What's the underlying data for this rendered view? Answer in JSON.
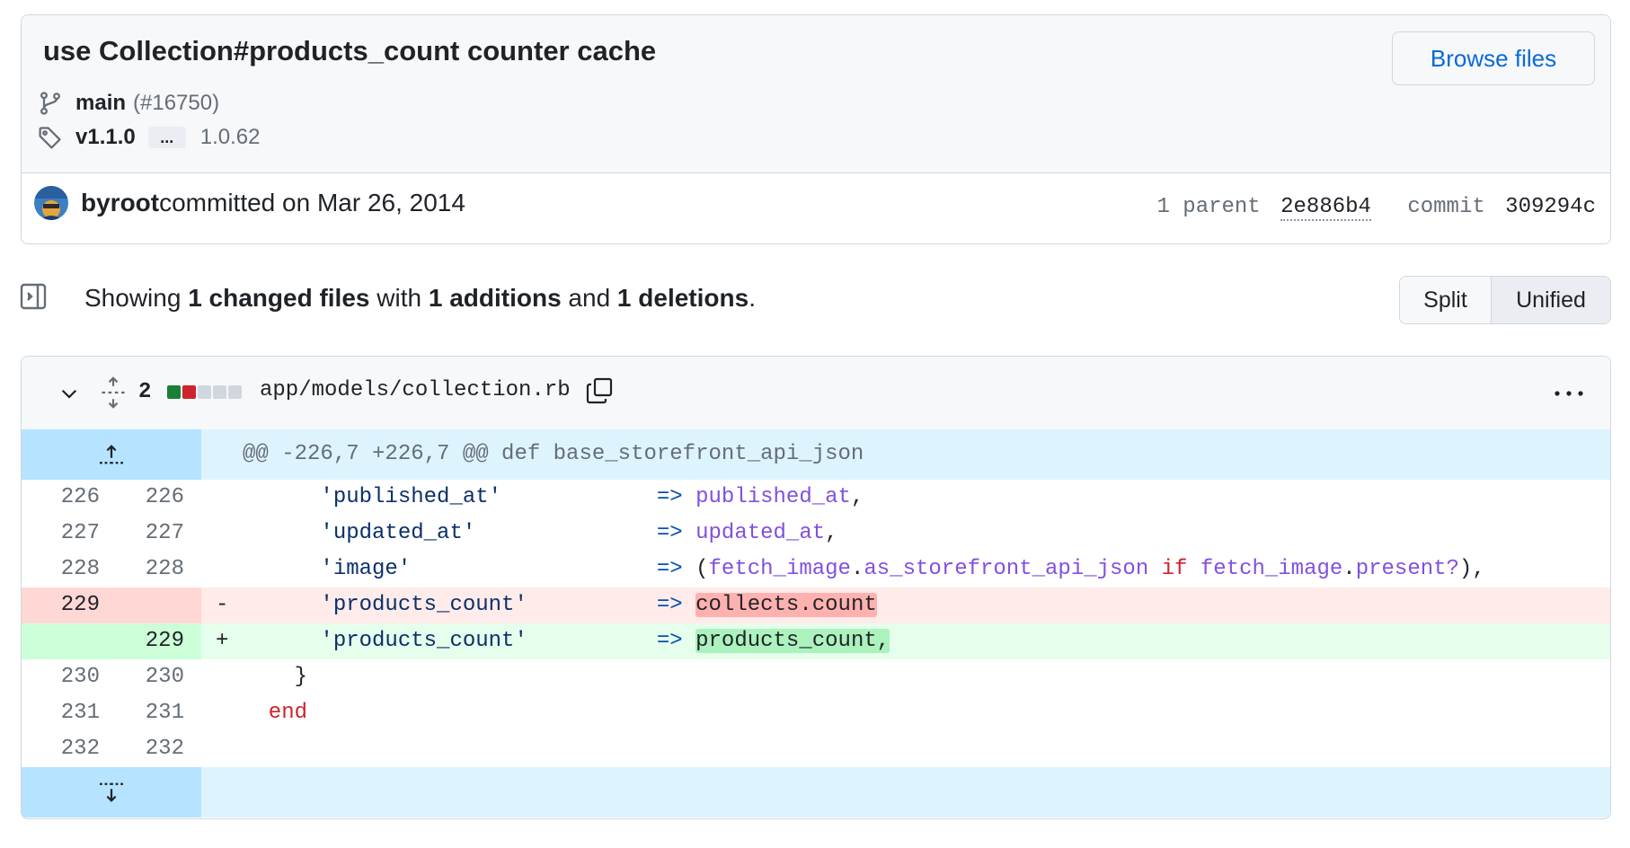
{
  "commit": {
    "title": "use Collection#products_count counter cache",
    "browse_files": "Browse files",
    "branch": "main",
    "pr": "(#16750)",
    "tag": "v1.1.0",
    "tag_ellipsis": "...",
    "tag_other": "1.0.62",
    "author": "byroot",
    "committed_text": " committed on Mar 26, 2014",
    "parent_label": "1 parent",
    "parent_sha": "2e886b4",
    "commit_label": "commit",
    "commit_sha": "309294c"
  },
  "summary": {
    "showing": "Showing ",
    "changed_files": "1 changed files",
    "with": " with ",
    "additions": "1 additions",
    "and": " and ",
    "deletions": "1 deletions",
    "period": ".",
    "split": "Split",
    "unified": "Unified"
  },
  "file": {
    "change_count": "2",
    "name": "app/models/collection.rb",
    "diffstat": [
      "#1a7f37",
      "#cf222e",
      "#d0d7de",
      "#d0d7de",
      "#d0d7de"
    ]
  },
  "diff": {
    "hunk_header": "@@ -226,7 +226,7 @@ def base_storefront_api_json",
    "lines": [
      {
        "type": "ctx",
        "old": "226",
        "new": "226",
        "key": "'published_at'",
        "arrow": "=>",
        "value": "published_at",
        "tail": ","
      },
      {
        "type": "ctx",
        "old": "227",
        "new": "227",
        "key": "'updated_at'",
        "arrow": "=>",
        "value": "updated_at",
        "tail": ","
      },
      {
        "type": "ctx",
        "old": "228",
        "new": "228",
        "key": "'image'",
        "arrow": "=>",
        "value": "(fetch_image.as_storefront_api_json if fetch_image.present?),"
      },
      {
        "type": "del",
        "old": "229",
        "new": "",
        "marker": "-",
        "key": "'products_count'",
        "arrow": "=>",
        "value": "collects.count"
      },
      {
        "type": "add",
        "old": "",
        "new": "229",
        "marker": "+",
        "key": "'products_count'",
        "arrow": "=>",
        "value": "products_count,"
      },
      {
        "type": "ctx",
        "old": "230",
        "new": "230",
        "code": "}"
      },
      {
        "type": "ctx",
        "old": "231",
        "new": "231",
        "code": "end"
      },
      {
        "type": "ctx",
        "old": "232",
        "new": "232",
        "code": ""
      }
    ]
  },
  "colors": {
    "link_blue": "#0969da",
    "add_bg": "#e6ffec",
    "del_bg": "#ffebe9",
    "hunk_bg": "#ddf4ff"
  }
}
